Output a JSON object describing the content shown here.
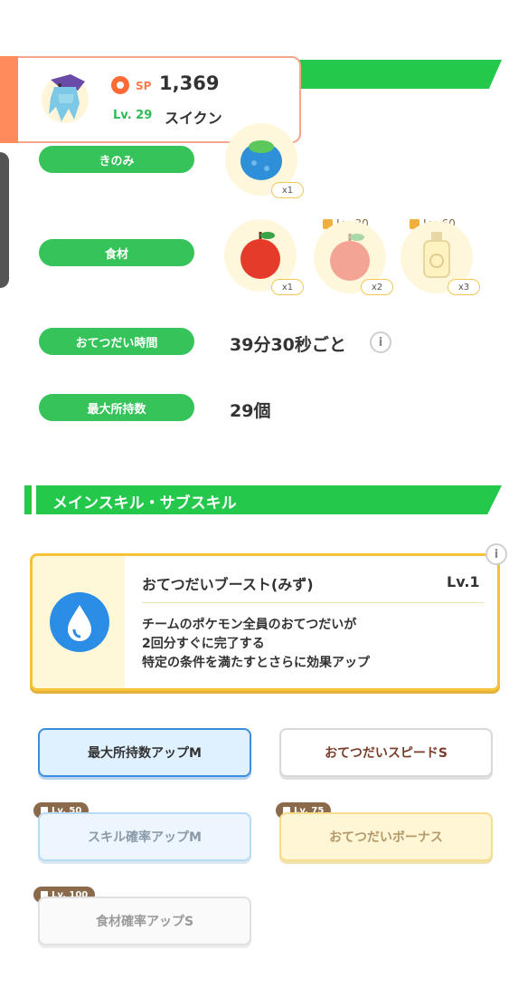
{
  "header": {
    "sp_label": "SP",
    "sp_value": "1,369",
    "level": "Lv. 29",
    "name": "スイクン"
  },
  "rows": {
    "berry": {
      "label": "きのみ",
      "count": "x1"
    },
    "ingredients": {
      "label": "食材",
      "items": [
        {
          "count": "x1",
          "lock": ""
        },
        {
          "count": "x2",
          "lock": "Lv. 30"
        },
        {
          "count": "x3",
          "lock": "Lv. 60"
        }
      ]
    },
    "help_time": {
      "label": "おてつだい時間",
      "value": "39分30秒ごと"
    },
    "max_carry": {
      "label": "最大所持数",
      "value": "29個"
    }
  },
  "section": {
    "title": "メインスキル・サブスキル"
  },
  "main_skill": {
    "name": "おてつだいブースト(みず)",
    "level": "Lv.1",
    "desc_line1": "チームのポケモン全員のおてつだいが",
    "desc_line2": "2回分すぐに完了する",
    "desc_line3": "特定の条件を満たすとさらに効果アップ"
  },
  "sub_skills": [
    {
      "label": "最大所持数アップM",
      "lock": ""
    },
    {
      "label": "おてつだいスピードS",
      "lock": ""
    },
    {
      "label": "スキル確率アップM",
      "lock": "Lv. 50"
    },
    {
      "label": "おてつだいボーナス",
      "lock": "Lv. 75"
    },
    {
      "label": "食材確率アップS",
      "lock": "Lv. 100"
    }
  ],
  "icons": {
    "info": "i",
    "sp": "sp-badge-icon",
    "lock": "lock-icon",
    "drop": "water-drop-icon"
  },
  "colors": {
    "green": "#24c94b",
    "accent_orange": "#ff8a5c",
    "skill_blue": "#2c8de6",
    "skill_border": "#f5c23a"
  }
}
